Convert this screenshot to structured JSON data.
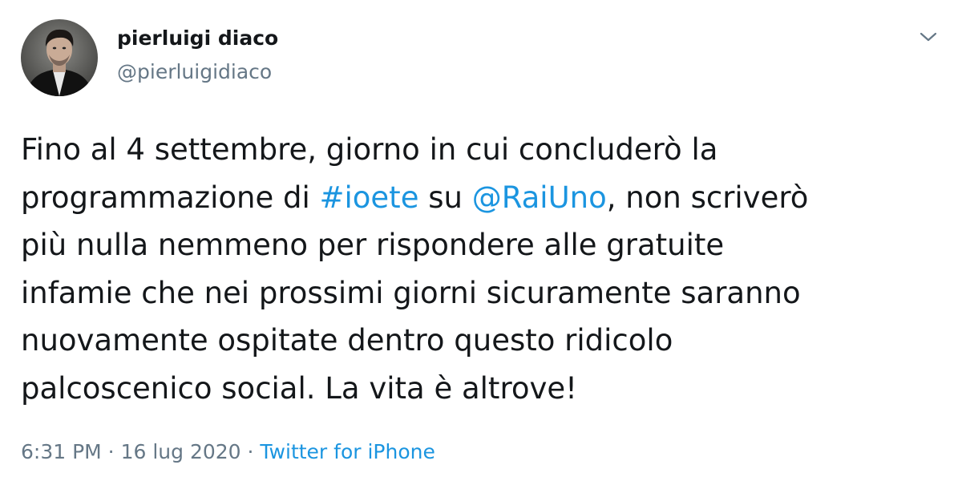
{
  "user": {
    "name": "pierluigi diaco",
    "handle": "@pierluigidiaco"
  },
  "tweet": {
    "lines": [
      [
        {
          "t": "Fino al 4 settembre, giorno in cui concluderò la"
        }
      ],
      [
        {
          "t": "programmazione di "
        },
        {
          "t": "#ioete",
          "link": true
        },
        {
          "t": " su "
        },
        {
          "t": "@RaiUno",
          "link": true
        },
        {
          "t": ", non scriverò"
        }
      ],
      [
        {
          "t": "più nulla nemmeno per rispondere alle gratuite"
        }
      ],
      [
        {
          "t": "infamie che nei prossimi giorni sicuramente saranno"
        }
      ],
      [
        {
          "t": "nuovamente ospitate dentro questo ridicolo"
        }
      ],
      [
        {
          "t": "palcoscenico social. La vita è altrove!"
        }
      ]
    ]
  },
  "meta": {
    "time": "6:31 PM",
    "dot1": " · ",
    "date": "16 lug 2020",
    "dot2": " · ",
    "source": "Twitter for iPhone"
  },
  "icons": {
    "caret": "chevron-down-icon"
  },
  "colors": {
    "link": "#1b95e0",
    "secondary": "#657786",
    "text": "#14171a"
  }
}
